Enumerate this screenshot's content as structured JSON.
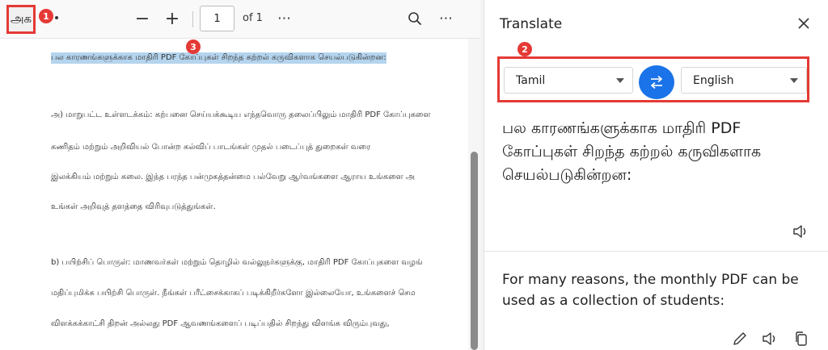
{
  "toolbar": {
    "translate_tool_glyph": "அக",
    "page_current": "1",
    "page_total": "of 1",
    "zoom_out_label": "−",
    "zoom_in_label": "+",
    "more_label": "⋯"
  },
  "annotations": [
    "1",
    "2",
    "3"
  ],
  "document": {
    "paragraphs": [
      "பல காரணங்களுக்காக மாதிரி PDF கோப்புகள் சிறந்த கற்றல் கருவிகளாக செயல்படுகின்றன:",
      "அ) மாறுபட்ட உள்ளடக்கம்: கற்பனை செய்யக்கூடிய எந்தவொரு தலைப்பிலும் மாதிரி PDF கோப்புகளை",
      "கணிதம் மற்றும் அறிவியல் போன்ற கல்விப் பாடங்கள் முதல் படைப்புத் துறைகள் வரை",
      "இலக்கியம் மற்றும் கலை. இந்த பரந்த பன்முகத்தன்மை பல்வேறு ஆர்வங்களை ஆராய உங்களை அ",
      "உங்கள் அறிவுத் தளத்தை விரிவுபடுத்துங்கள்.",
      "b) பயிற்சிப் பொருள்: மாணவர்கள் மற்றும் தொழில் வல்லுநர்களுக்கு, மாதிரி PDF கோப்புகளை வழங்",
      "மதிப்புமிக்க பயிற்சி பொருள். நீங்கள் பரீட்சைக்காகப் படிக்கிறீர்களோ இல்லையோ, உங்களைச் செம",
      "விளக்கக்காட்சி திறன் அல்லது PDF ஆவணங்களைப் படிப்பதில் சிறந்து விளங்க விரும்புவது,"
    ]
  },
  "translate": {
    "title": "Translate",
    "source_language": "Tamil",
    "target_language": "English",
    "source_text": "பல காரணங்களுக்காக மாதிரி PDF கோப்புகள் சிறந்த கற்றல் கருவிகளாக செயல்படுகின்றன:",
    "translated_text": "For many reasons, the monthly PDF can be used as a collection of students:"
  },
  "colors": {
    "accent": "#1a73e8",
    "annotation": "#e53935",
    "highlight": "#b5d4ee"
  }
}
